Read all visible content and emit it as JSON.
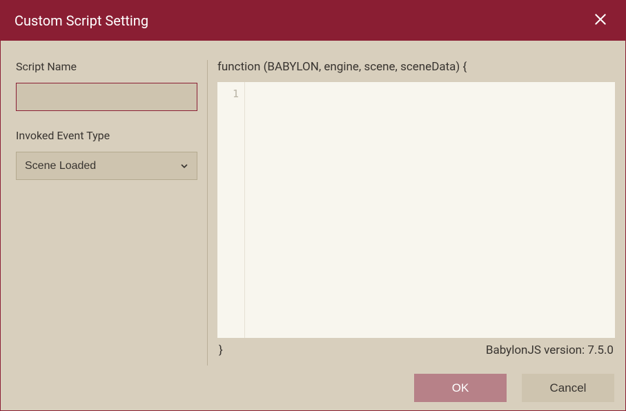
{
  "dialog": {
    "title": "Custom Script Setting"
  },
  "form": {
    "script_name_label": "Script Name",
    "script_name_value": "",
    "invoked_event_type_label": "Invoked Event Type",
    "invoked_event_type_value": "Scene Loaded"
  },
  "editor": {
    "fn_open": "function (BABYLON, engine, scene, sceneData) {",
    "fn_close": "}",
    "line_number": "1",
    "code": "",
    "version_label": "BabylonJS version: 7.5.0"
  },
  "buttons": {
    "ok": "OK",
    "cancel": "Cancel"
  }
}
